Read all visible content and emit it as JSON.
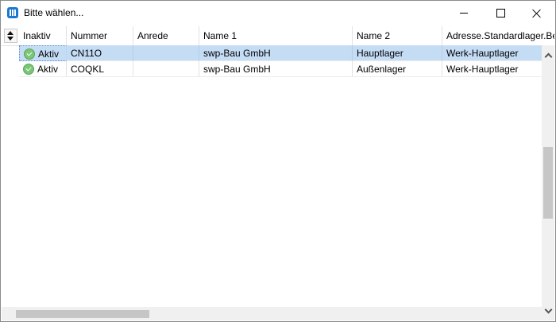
{
  "window": {
    "title": "Bitte wählen..."
  },
  "grid": {
    "columns": [
      "Inaktiv",
      "Nummer",
      "Anrede",
      "Name 1",
      "Name 2",
      "Adresse.Standardlager.Bez"
    ],
    "rows": [
      {
        "inaktiv": "Aktiv",
        "nummer": "CN11O",
        "anrede": "",
        "name1": "swp-Bau GmbH",
        "name2": "Hauptlager",
        "lager": "Werk-Hauptlager",
        "selected": true
      },
      {
        "inaktiv": "Aktiv",
        "nummer": "COQKL",
        "anrede": "",
        "name1": "swp-Bau GmbH",
        "name2": "Außenlager",
        "lager": "Werk-Hauptlager",
        "selected": false
      }
    ]
  },
  "icons": {
    "app": "grid-icon",
    "status": "check-circle-icon",
    "sort": "sort-updown-icon"
  },
  "colors": {
    "selection": "#c5dcf5",
    "accent": "#1b78d0",
    "status_ok": "#7cc576"
  }
}
